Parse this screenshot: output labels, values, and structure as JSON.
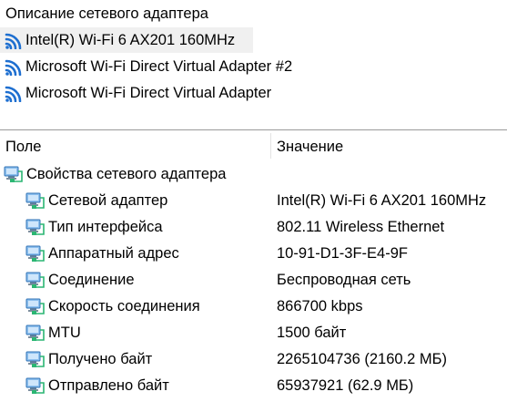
{
  "adapters_panel": {
    "header": "Описание сетевого адаптера",
    "items": [
      {
        "label": "Intel(R) Wi-Fi 6 AX201 160MHz",
        "selected": true
      },
      {
        "label": "Microsoft Wi-Fi Direct Virtual Adapter #2",
        "selected": false
      },
      {
        "label": "Microsoft Wi-Fi Direct Virtual Adapter",
        "selected": false
      }
    ]
  },
  "properties_panel": {
    "columns": {
      "field": "Поле",
      "value": "Значение"
    },
    "group": {
      "label": "Свойства сетевого адаптера",
      "icon": "network-adapter-icon"
    },
    "rows": [
      {
        "name": "Сетевой адаптер",
        "value": "Intel(R) Wi-Fi 6 AX201 160MHz",
        "icon": "network-adapter-icon"
      },
      {
        "name": "Тип интерфейса",
        "value": "802.11 Wireless Ethernet",
        "icon": "network-adapter-icon"
      },
      {
        "name": "Аппаратный адрес",
        "value": "10-91-D1-3F-E4-9F",
        "icon": "network-adapter-icon"
      },
      {
        "name": "Соединение",
        "value": "Беспроводная сеть",
        "icon": "network-adapter-icon"
      },
      {
        "name": "Скорость соединения",
        "value": "866700 kbps",
        "icon": "network-adapter-icon"
      },
      {
        "name": "MTU",
        "value": "1500 байт",
        "icon": "network-adapter-icon"
      },
      {
        "name": "Получено байт",
        "value": "2265104736 (2160.2 МБ)",
        "icon": "network-adapter-icon"
      },
      {
        "name": "Отправлено байт",
        "value": "65937921 (62.9 МБ)",
        "icon": "network-adapter-icon"
      }
    ]
  },
  "colors": {
    "wifi_icon": "#1e6fd0",
    "selection_bg": "#f0f0f0",
    "divider": "#9a9a9a"
  }
}
